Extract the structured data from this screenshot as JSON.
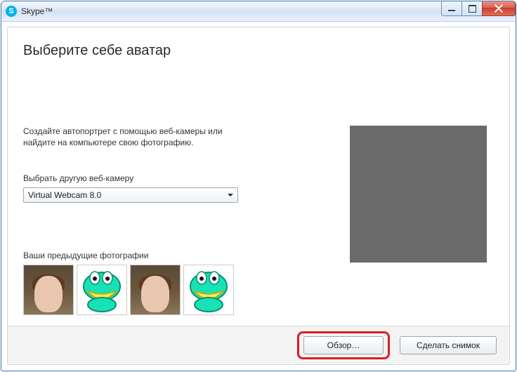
{
  "window": {
    "title": "Skype™",
    "icon_letter": "S"
  },
  "heading": "Выберите себе аватар",
  "instructions": "Создайте автопортрет с помощью веб-камеры или найдите на компьютере свою фотографию.",
  "webcam": {
    "label": "Выбрать другую веб-камеру",
    "selected": "Virtual Webcam 8.0"
  },
  "previous": {
    "label": "Ваши предыдущие фотографии"
  },
  "buttons": {
    "browse": "Обзор…",
    "snapshot": "Сделать снимок"
  }
}
